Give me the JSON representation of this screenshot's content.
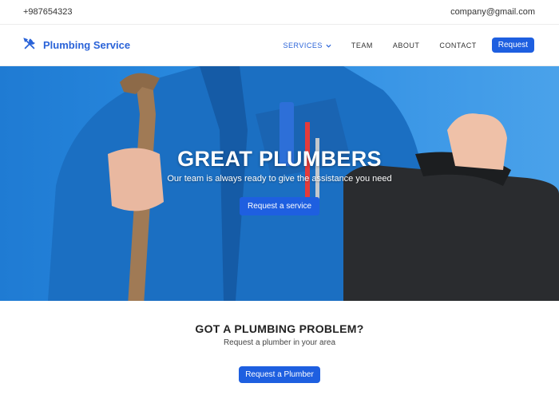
{
  "topbar": {
    "phone": "+987654323",
    "email": "company@gmail.com"
  },
  "brand": {
    "name": "Plumbing Service",
    "icon": "tools-icon"
  },
  "nav": {
    "services": "SERVICES",
    "team": "TEAM",
    "about": "ABOUT",
    "contact": "CONTACT",
    "request": "Request"
  },
  "hero": {
    "title": "GREAT PLUMBERS",
    "subtitle": "Our team is always ready to give the assistance you need",
    "button": "Request a service"
  },
  "section": {
    "title": "GOT A PLUMBING PROBLEM?",
    "subtitle": "Request a plumber in your area",
    "button": "Request a Plumber"
  },
  "colors": {
    "accent": "#1e5fe0",
    "hero_bg": "#2a8be0"
  }
}
